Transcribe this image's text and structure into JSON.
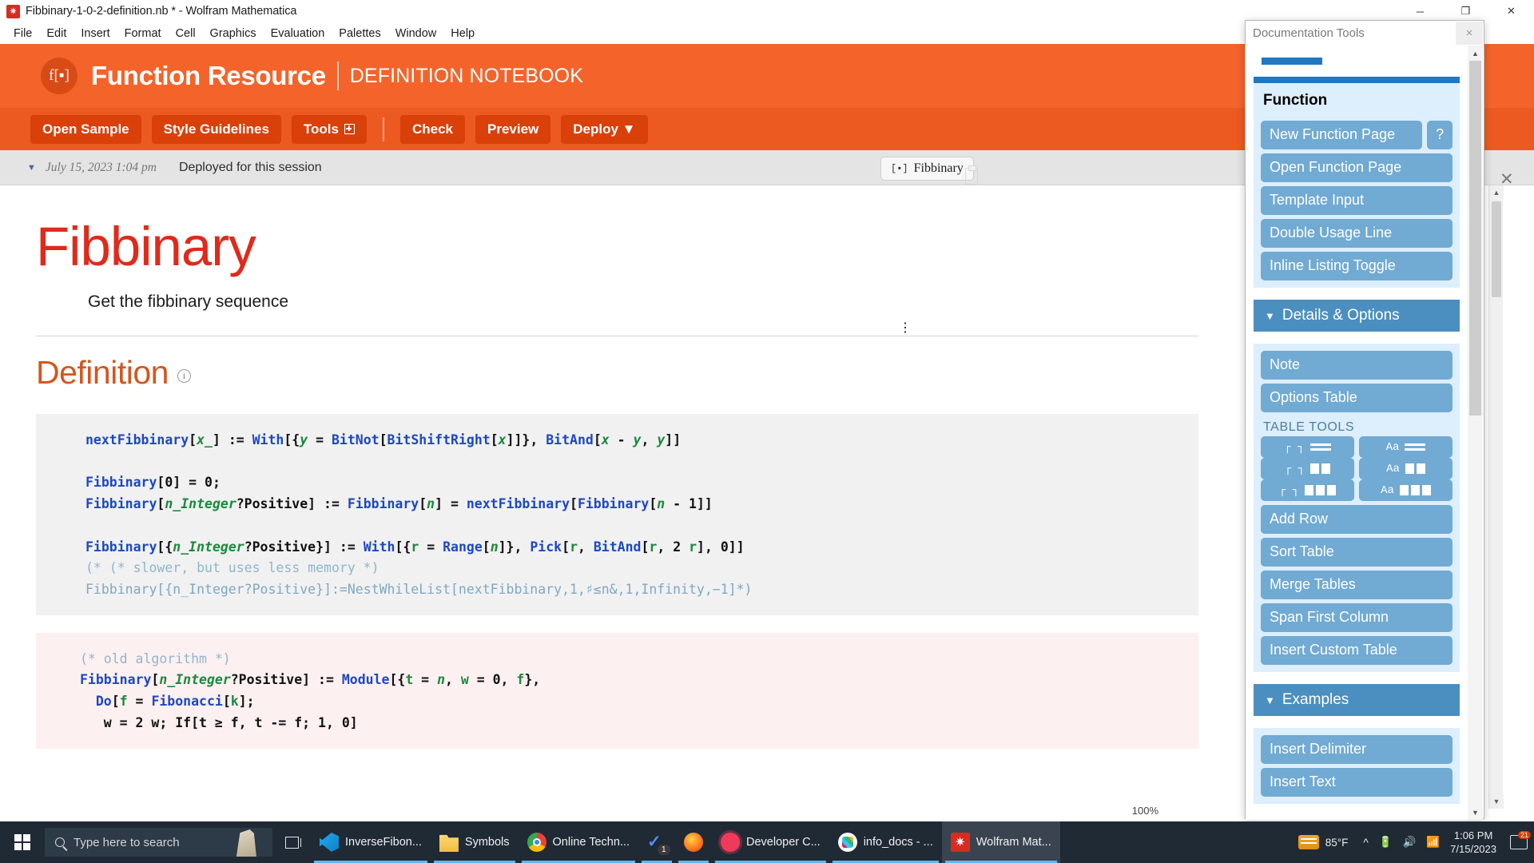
{
  "titlebar": {
    "app_icon": "wolfram-spikey-icon",
    "title": "Fibbinary-1-0-2-definition.nb * - Wolfram Mathematica",
    "minimize": "─",
    "maximize": "❐",
    "close": "✕"
  },
  "menubar": {
    "items": [
      "File",
      "Edit",
      "Insert",
      "Format",
      "Cell",
      "Graphics",
      "Evaluation",
      "Palettes",
      "Window",
      "Help"
    ]
  },
  "banner": {
    "logo_text": "f[▪]",
    "title": "Function Resource",
    "subtitle": "DEFINITION NOTEBOOK",
    "bg_color": "#f4642a"
  },
  "toolbar": {
    "open_sample": "Open Sample",
    "style_guidelines": "Style Guidelines",
    "tools": "Tools",
    "check": "Check",
    "preview": "Preview",
    "deploy": "Deploy ▼",
    "button_color": "#d9400a"
  },
  "deploy_bar": {
    "caret": "▼",
    "date": "July 15, 2023 1:04 pm",
    "status": "Deployed for this session",
    "chip_mark": "[▪]",
    "chip_label": "Fibbinary"
  },
  "notebook": {
    "title": "Fibbinary",
    "title_color": "#e02a1b",
    "caption": "Get the fibbinary sequence",
    "section_heading": "Definition",
    "section_heading_color": "#d4561f",
    "info_icon": "ⓘ",
    "close_icon": "✕",
    "code_cell_1": [
      [
        {
          "t": "nextFibbinary",
          "c": "fn"
        },
        {
          "t": "[",
          "c": "blk"
        },
        {
          "t": "x_",
          "c": "var"
        },
        {
          "t": "] := ",
          "c": "blk"
        },
        {
          "t": "With",
          "c": "fn"
        },
        {
          "t": "[{",
          "c": "blk"
        },
        {
          "t": "y",
          "c": "var"
        },
        {
          "t": " = ",
          "c": "blk"
        },
        {
          "t": "BitNot",
          "c": "fn"
        },
        {
          "t": "[",
          "c": "blk"
        },
        {
          "t": "BitShiftRight",
          "c": "fn"
        },
        {
          "t": "[",
          "c": "blk"
        },
        {
          "t": "x",
          "c": "var"
        },
        {
          "t": "]]}, ",
          "c": "blk"
        },
        {
          "t": "BitAnd",
          "c": "fn"
        },
        {
          "t": "[",
          "c": "blk"
        },
        {
          "t": "x",
          "c": "var"
        },
        {
          "t": " - ",
          "c": "blk"
        },
        {
          "t": "y",
          "c": "var"
        },
        {
          "t": ", ",
          "c": "blk"
        },
        {
          "t": "y",
          "c": "var"
        },
        {
          "t": "]]",
          "c": "blk"
        }
      ],
      [],
      [
        {
          "t": "Fibbinary",
          "c": "fn"
        },
        {
          "t": "[0] = 0;",
          "c": "blk"
        }
      ],
      [
        {
          "t": "Fibbinary",
          "c": "fn"
        },
        {
          "t": "[",
          "c": "blk"
        },
        {
          "t": "n_Integer",
          "c": "var"
        },
        {
          "t": "?Positive] := ",
          "c": "blk"
        },
        {
          "t": "Fibbinary",
          "c": "fn"
        },
        {
          "t": "[",
          "c": "blk"
        },
        {
          "t": "n",
          "c": "var"
        },
        {
          "t": "] = ",
          "c": "blk"
        },
        {
          "t": "nextFibbinary",
          "c": "fn"
        },
        {
          "t": "[",
          "c": "blk"
        },
        {
          "t": "Fibbinary",
          "c": "fn"
        },
        {
          "t": "[",
          "c": "blk"
        },
        {
          "t": "n",
          "c": "var"
        },
        {
          "t": " - 1]]",
          "c": "blk"
        }
      ],
      [],
      [
        {
          "t": "Fibbinary",
          "c": "fn"
        },
        {
          "t": "[{",
          "c": "blk"
        },
        {
          "t": "n_Integer",
          "c": "var"
        },
        {
          "t": "?Positive}] := ",
          "c": "blk"
        },
        {
          "t": "With",
          "c": "fn"
        },
        {
          "t": "[{",
          "c": "blk"
        },
        {
          "t": "r",
          "c": "local"
        },
        {
          "t": " = ",
          "c": "blk"
        },
        {
          "t": "Range",
          "c": "fn"
        },
        {
          "t": "[",
          "c": "blk"
        },
        {
          "t": "n",
          "c": "var"
        },
        {
          "t": "]}, ",
          "c": "blk"
        },
        {
          "t": "Pick",
          "c": "fn"
        },
        {
          "t": "[",
          "c": "blk"
        },
        {
          "t": "r",
          "c": "local"
        },
        {
          "t": ", ",
          "c": "blk"
        },
        {
          "t": "BitAnd",
          "c": "fn"
        },
        {
          "t": "[",
          "c": "blk"
        },
        {
          "t": "r",
          "c": "local"
        },
        {
          "t": ", 2 ",
          "c": "blk"
        },
        {
          "t": "r",
          "c": "local"
        },
        {
          "t": "], 0]]",
          "c": "blk"
        }
      ],
      [
        {
          "t": "(* (* slower, but uses less memory *)",
          "c": "cmt"
        }
      ],
      [
        {
          "t": "Fibbinary[{n_Integer?Positive}]:=",
          "c": "dim"
        },
        {
          "t": "NestWhileList",
          "c": "dim"
        },
        {
          "t": "[nextFibbinary,1,♯≤n&,1,Infinity,−1]*)",
          "c": "dim"
        }
      ]
    ],
    "code_cell_2": [
      [
        {
          "t": "(* old algorithm *)",
          "c": "cmt"
        }
      ],
      [
        {
          "t": "Fibbinary",
          "c": "fn"
        },
        {
          "t": "[",
          "c": "blk"
        },
        {
          "t": "n_Integer",
          "c": "var"
        },
        {
          "t": "?Positive] := ",
          "c": "blk"
        },
        {
          "t": "Module",
          "c": "fn"
        },
        {
          "t": "[{",
          "c": "blk"
        },
        {
          "t": "t",
          "c": "local"
        },
        {
          "t": " = ",
          "c": "blk"
        },
        {
          "t": "n",
          "c": "var"
        },
        {
          "t": ", ",
          "c": "blk"
        },
        {
          "t": "w",
          "c": "local"
        },
        {
          "t": " = 0, ",
          "c": "blk"
        },
        {
          "t": "f",
          "c": "local"
        },
        {
          "t": "},",
          "c": "blk"
        }
      ],
      [
        {
          "t": "  ",
          "c": "blk"
        },
        {
          "t": "Do",
          "c": "fn"
        },
        {
          "t": "[",
          "c": "blk"
        },
        {
          "t": "f",
          "c": "local"
        },
        {
          "t": " = ",
          "c": "blk"
        },
        {
          "t": "Fibonacci",
          "c": "fn"
        },
        {
          "t": "[",
          "c": "blk"
        },
        {
          "t": "k",
          "c": "local"
        },
        {
          "t": "];",
          "c": "blk"
        }
      ],
      [
        {
          "t": "   w = 2 w; If[t ≥ f, t -= f; 1, 0]",
          "c": "blk"
        }
      ]
    ]
  },
  "palette": {
    "title": "Documentation Tools",
    "close": "×",
    "function_group": {
      "heading": "Function",
      "new_function_page": "New Function Page",
      "help": "?",
      "buttons": [
        "Open Function Page",
        "Template Input",
        "Double Usage Line",
        "Inline Listing Toggle"
      ]
    },
    "details_section": {
      "triangle": "▼",
      "heading": "Details & Options",
      "buttons": [
        "Note",
        "Options Table"
      ],
      "table_tools_label": "TABLE TOOLS",
      "table_tool_rows": [
        {
          "left_glyph": "┌ ┐",
          "left_bars": 1,
          "right_glyph": "Aa",
          "right_bars": 1
        },
        {
          "left_glyph": "┌ ┐",
          "left_bars": 2,
          "right_glyph": "Aa",
          "right_bars": 2
        },
        {
          "left_glyph": "┌ ┐",
          "left_bars": 3,
          "right_glyph": "Aa",
          "right_bars": 3
        }
      ],
      "more_buttons": [
        "Add Row",
        "Sort Table",
        "Merge Tables",
        "Span First Column",
        "Insert Custom Table"
      ]
    },
    "examples_section": {
      "triangle": "▼",
      "heading": "Examples",
      "buttons": [
        "Insert Delimiter",
        "Insert Text"
      ]
    }
  },
  "taskbar": {
    "search_placeholder": "Type here to search",
    "items": [
      {
        "label": "InverseFibon...",
        "icon": "vscode-icon",
        "active": false
      },
      {
        "label": "Symbols",
        "icon": "folder-icon",
        "active": false
      },
      {
        "label": "Online Techn...",
        "icon": "chrome-icon",
        "active": false
      },
      {
        "label": "",
        "icon": "todoist-icon",
        "active": false,
        "badge": "1"
      },
      {
        "label": "",
        "icon": "firefox-icon",
        "active": false
      },
      {
        "label": "Developer C...",
        "icon": "record-icon",
        "active": false
      },
      {
        "label": "info_docs - ...",
        "icon": "slack-icon",
        "active": false
      },
      {
        "label": "Wolfram Mat...",
        "icon": "wolfram-icon",
        "active": true
      }
    ],
    "temperature": "85°F",
    "time": "1:06 PM",
    "date": "7/15/2023",
    "notification_count": "21"
  },
  "zoom": {
    "level": "100%"
  }
}
